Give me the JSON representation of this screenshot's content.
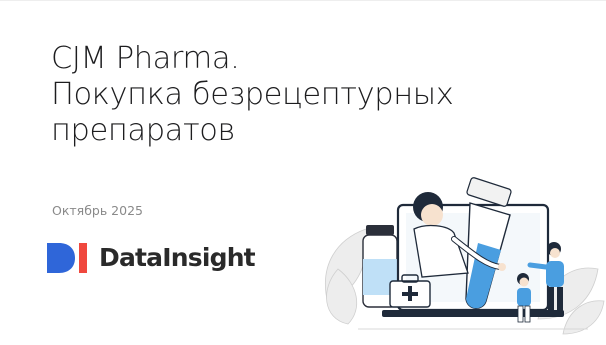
{
  "slide": {
    "title_lines": [
      "CJM Pharma.",
      "Покупка безрецептурных",
      "препаратов"
    ],
    "date": "Октябрь 2025",
    "logo": {
      "text": "DataInsight",
      "colors": {
        "blue": "#2f66d9",
        "red": "#f0483e",
        "text": "#2a2a2a"
      }
    },
    "illustration": {
      "icons": [
        "medicine-bottle-icon",
        "first-aid-kit-icon",
        "laptop-icon",
        "doctor-icon",
        "people-icon",
        "leaf-icon"
      ],
      "colors": {
        "accent_blue": "#4a9ee0",
        "light_blue": "#bfe0f7",
        "dark": "#1f2a3a",
        "leaf": "#e6e6e6"
      }
    }
  }
}
